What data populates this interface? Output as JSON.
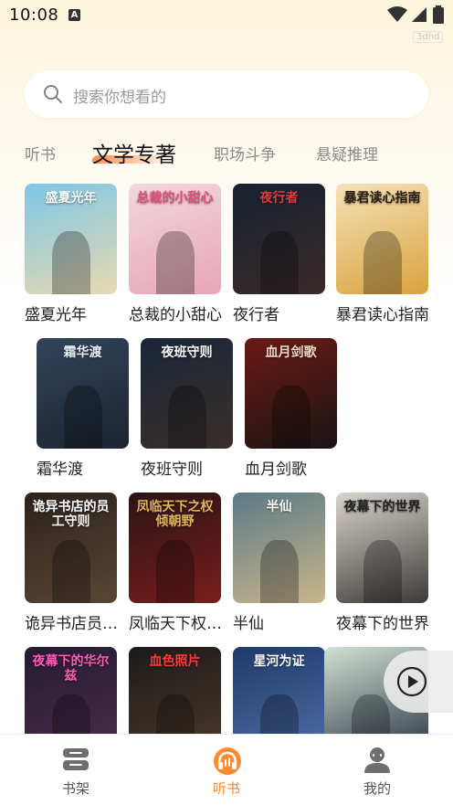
{
  "status_bar": {
    "time": "10:08",
    "notification_icon": "A",
    "watermark": "3dhd"
  },
  "search": {
    "placeholder": "搜索你想看的"
  },
  "tabs": [
    {
      "label": "听书",
      "active": false
    },
    {
      "label": "文学专著",
      "active": true
    },
    {
      "label": "职场斗争",
      "active": false
    },
    {
      "label": "悬疑推理",
      "active": false
    }
  ],
  "books": [
    {
      "title": "盛夏光年",
      "cover_text": "盛夏光年",
      "cover_colors": [
        "#7cc7e8",
        "#e8d9b0"
      ],
      "cover_text_color": "#ffffff"
    },
    {
      "title": "总裁的小甜心",
      "cover_text": "总裁的小甜心",
      "cover_colors": [
        "#f3d7dd",
        "#e6a5b4"
      ],
      "cover_text_color": "#e24c79"
    },
    {
      "title": "夜行者",
      "cover_text": "夜行者",
      "cover_colors": [
        "#17222f",
        "#3a2a2a"
      ],
      "cover_text_color": "#e23c3c"
    },
    {
      "title": "暴君读心指南",
      "cover_text": "暴君读心指南",
      "cover_colors": [
        "#f4e2b8",
        "#d9a33c"
      ],
      "cover_text_color": "#2b1d12"
    },
    {
      "title": "霜华渡",
      "cover_text": "霜华渡",
      "cover_colors": [
        "#32445a",
        "#1c2430"
      ],
      "cover_text_color": "#e8eef5"
    },
    {
      "title": "夜班守则",
      "cover_text": "夜班守则",
      "cover_colors": [
        "#1a2638",
        "#3a2f2a"
      ],
      "cover_text_color": "#ffffff"
    },
    {
      "title": "血月剑歌",
      "cover_text": "血月剑歌",
      "cover_colors": [
        "#6b1a14",
        "#1a1414"
      ],
      "cover_text_color": "#f2d9c9"
    },
    {
      "title": "诡异书店员工守则",
      "cover_text": "诡异书店的员工守则",
      "cover_colors": [
        "#2b221c",
        "#5a4634"
      ],
      "cover_text_color": "#ffffff"
    },
    {
      "title": "凤临天下权倾朝野",
      "cover_text": "凤临天下之权倾朝野",
      "cover_colors": [
        "#2a1414",
        "#7a1d1d"
      ],
      "cover_text_color": "#e0b65a"
    },
    {
      "title": "半仙",
      "cover_text": "半仙",
      "cover_colors": [
        "#5b7a86",
        "#c9b58b"
      ],
      "cover_text_color": "#ffffff"
    },
    {
      "title": "夜幕下的世界",
      "cover_text": "夜幕下的世界",
      "cover_colors": [
        "#d9d4cc",
        "#3d3a38"
      ],
      "cover_text_color": "#222222"
    },
    {
      "title": "夜幕下的华尔兹",
      "cover_text": "夜幕下的华尔兹",
      "cover_colors": [
        "#241b33",
        "#4a2e4a"
      ],
      "cover_text_color": "#ff5ab5"
    },
    {
      "title": "血色照片",
      "cover_text": "血色照片",
      "cover_colors": [
        "#1d1a1a",
        "#4a3a2a"
      ],
      "cover_text_color": "#ff3b3b"
    },
    {
      "title": "星河为证",
      "cover_text": "星河为证",
      "cover_colors": [
        "#1f3a6a",
        "#4f6fa6"
      ],
      "cover_text_color": "#ffffff"
    },
    {
      "title": "",
      "cover_text": "",
      "cover_colors": [
        "#cfe2d3",
        "#2a3142"
      ],
      "cover_text_color": "#ffffff"
    }
  ],
  "player": {
    "icon": "play-icon"
  },
  "bottom_nav": [
    {
      "label": "书架",
      "icon": "bookshelf-icon",
      "active": false
    },
    {
      "label": "听书",
      "icon": "headphones-icon",
      "active": true
    },
    {
      "label": "我的",
      "icon": "user-icon",
      "active": false
    }
  ],
  "colors": {
    "accent": "#ff8a2e"
  }
}
